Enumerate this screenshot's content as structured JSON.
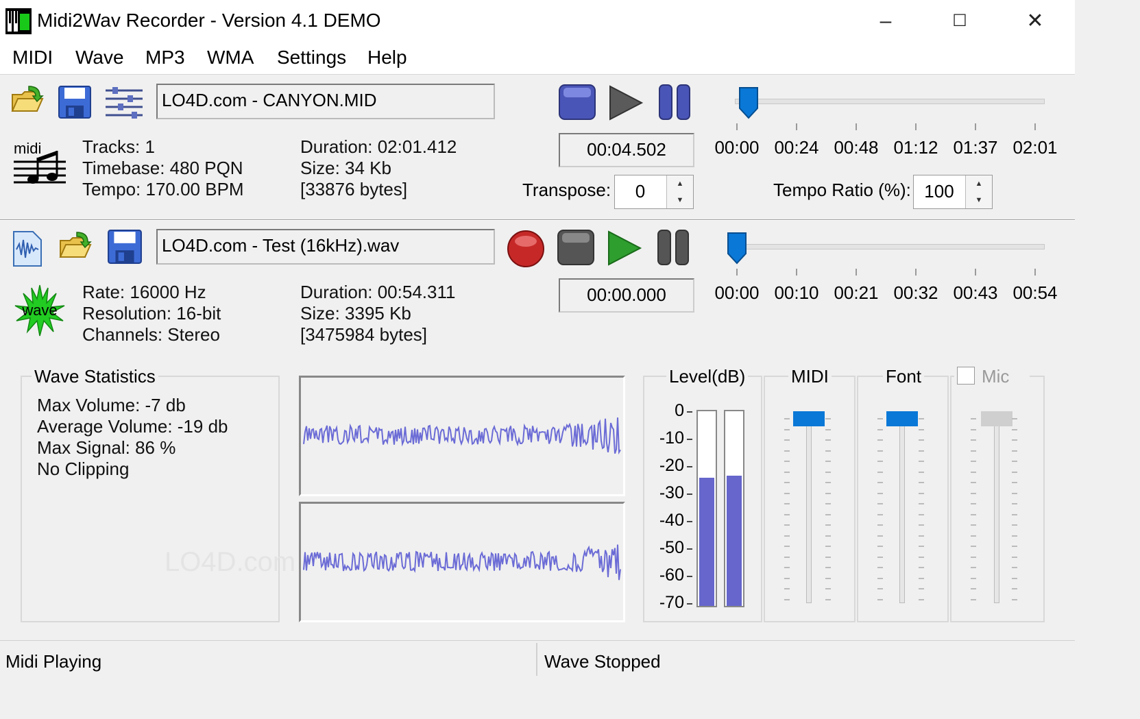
{
  "window": {
    "title": "Midi2Wav Recorder - Version 4.1 DEMO",
    "minimize_glyph": "–",
    "maximize_glyph": "☐",
    "close_glyph": "✕"
  },
  "menu": [
    "MIDI",
    "Wave",
    "MP3",
    "WMA",
    "Settings",
    "Help"
  ],
  "midi": {
    "file_name": "LO4D.com - CANYON.MID",
    "icon_label": "midi",
    "tracks": "Tracks: 1",
    "timebase": "Timebase: 480 PQN",
    "tempo": "Tempo: 170.00 BPM",
    "duration": "Duration: 02:01.412",
    "size": "Size: 34 Kb",
    "bytes": "[33876 bytes]",
    "time": "00:04.502",
    "transpose_label": "Transpose:",
    "transpose_value": "0",
    "tempo_ratio_label": "Tempo Ratio (%):",
    "tempo_ratio_value": "100",
    "timeline_labels": [
      "00:00",
      "00:24",
      "00:48",
      "01:12",
      "01:37",
      "02:01"
    ],
    "position_fraction": 0.04
  },
  "wave": {
    "file_name": "LO4D.com - Test (16kHz).wav",
    "icon_label": "wave",
    "rate": "Rate: 16000 Hz",
    "resolution": "Resolution: 16-bit",
    "channels": "Channels: Stereo",
    "duration": "Duration: 00:54.311",
    "size": "Size: 3395 Kb",
    "bytes": "[3475984 bytes]",
    "time": "00:00.000",
    "timeline_labels": [
      "00:00",
      "00:10",
      "00:21",
      "00:32",
      "00:43",
      "00:54"
    ],
    "position_fraction": 0.0
  },
  "statistics": {
    "title": "Wave Statistics",
    "max_volume": "Max Volume: -7 db",
    "average_volume": "Average Volume: -19 db",
    "max_signal": "Max Signal: 86 %",
    "clipping": "No Clipping"
  },
  "level": {
    "title": "Level(dB)",
    "scale": [
      "0",
      "-10",
      "-20",
      "-30",
      "-40",
      "-50",
      "-60",
      "-70"
    ],
    "left_fraction": 0.66,
    "right_fraction": 0.67
  },
  "mixer": {
    "midi_label": "MIDI",
    "font_label": "Font",
    "mic_label": "Mic",
    "mic_checked": false
  },
  "status": {
    "midi": "Midi Playing",
    "wave": "Wave Stopped"
  },
  "watermark": "LO4D.com",
  "colors": {
    "accent_blue": "#0a78d7",
    "waveform": "#6b6bd6",
    "meter": "#6666cc",
    "record": "#c62828",
    "play_green": "#2e9e2e"
  }
}
